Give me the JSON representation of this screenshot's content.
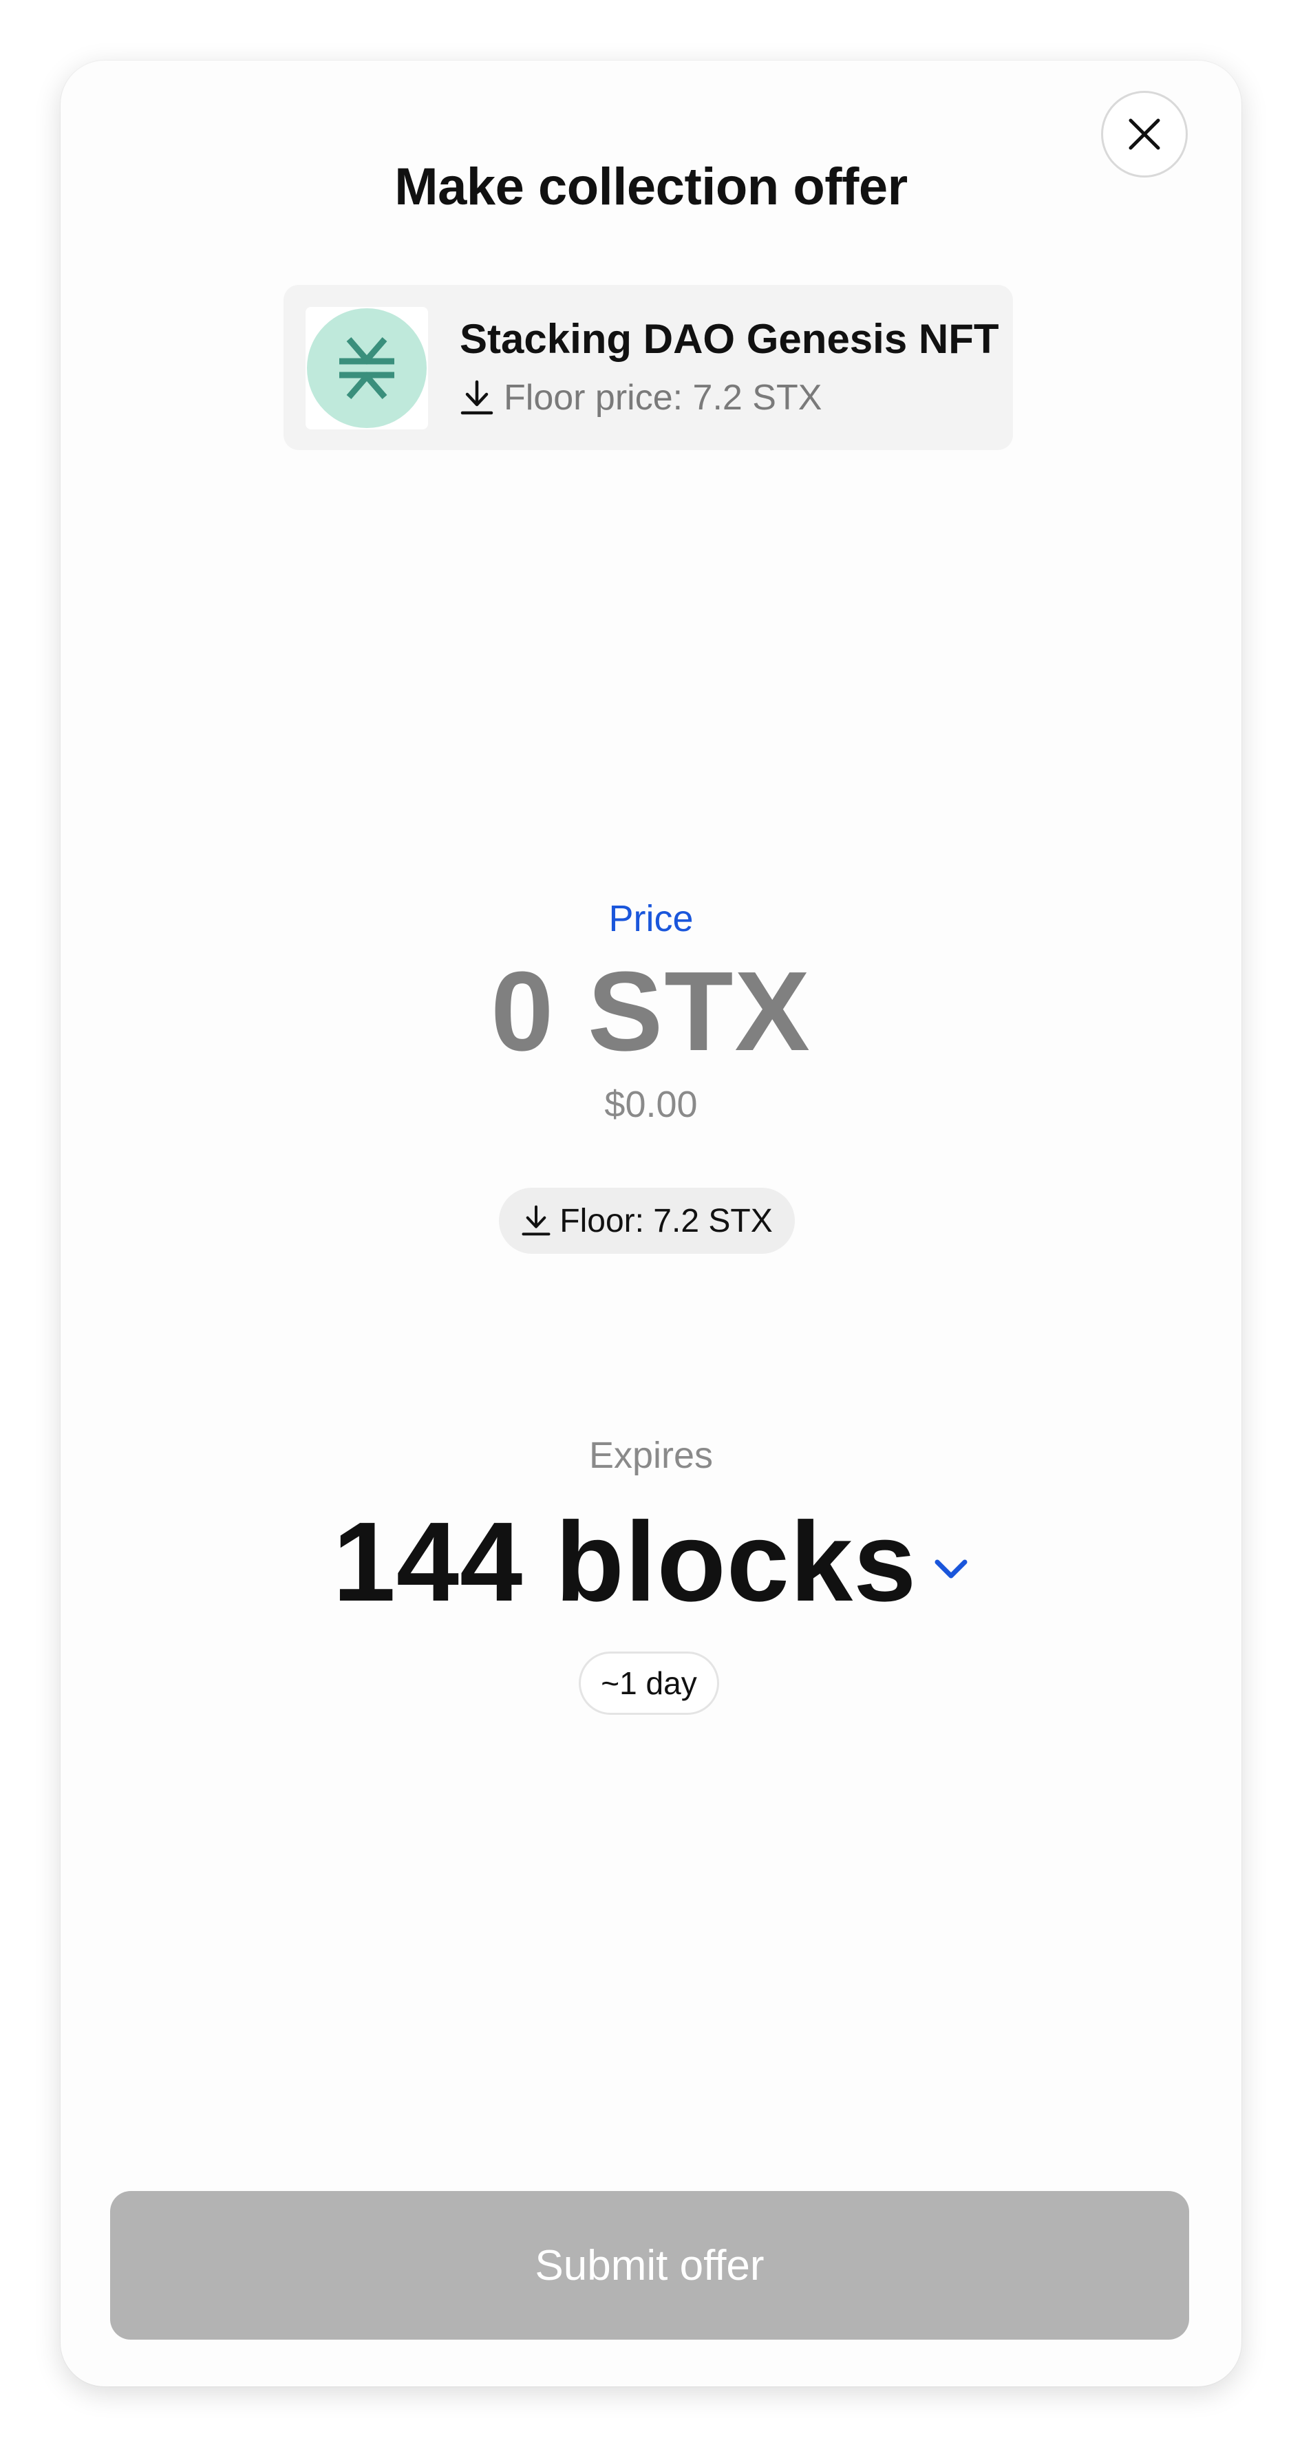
{
  "modal": {
    "title": "Make collection offer",
    "close_icon": "close-icon"
  },
  "collection": {
    "name": "Stacking DAO Genesis NFT",
    "floor_text": "Floor price: 7.2 STX",
    "avatar_icon": "stacks-logo-icon",
    "floor_icon": "download-arrow-icon"
  },
  "price": {
    "label": "Price",
    "value": "0 STX",
    "usd": "$0.00",
    "floor_pill": "Floor: 7.2 STX"
  },
  "expires": {
    "label": "Expires",
    "value": "144 blocks",
    "duration": "~1 day",
    "dropdown_icon": "chevron-down-icon"
  },
  "actions": {
    "submit_label": "Submit offer"
  },
  "colors": {
    "accent": "#1a56db",
    "avatar_bg": "#bfe9db",
    "avatar_mark": "#3a8f7c",
    "submit_disabled": "#b3b3b3",
    "muted_text": "#808080"
  }
}
